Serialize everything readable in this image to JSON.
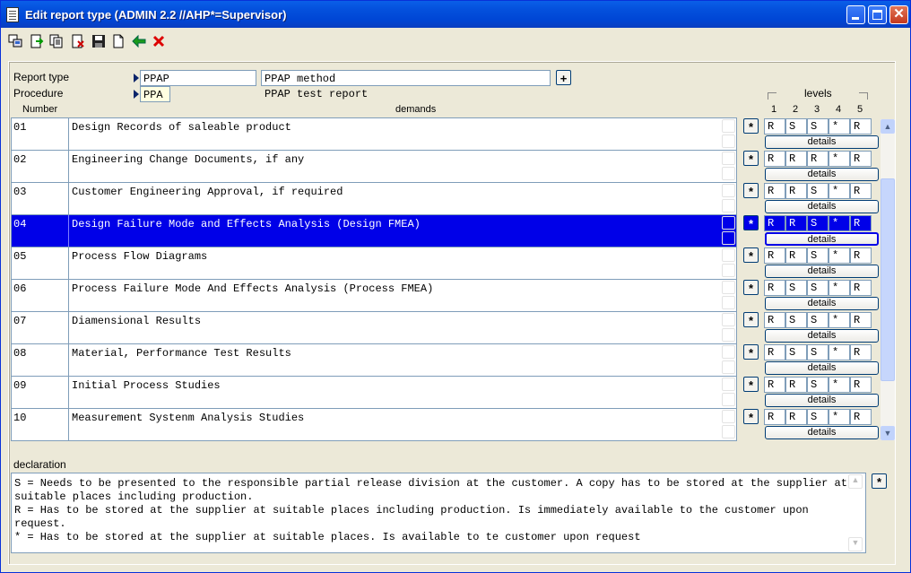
{
  "window": {
    "title": "Edit report type (ADMIN 2.2 //AHP*=Supervisor)"
  },
  "form": {
    "report_type_label": "Report type",
    "report_type_value": "PPAP",
    "report_type_desc": "PPAP method",
    "procedure_label": "Procedure",
    "procedure_value": "PPA",
    "procedure_desc": "PPAP test report",
    "add_button": "+"
  },
  "grid": {
    "col_number": "Number",
    "col_demands": "demands",
    "levels_label": "levels",
    "level_headers": [
      "1",
      "2",
      "3",
      "4",
      "5"
    ],
    "details_label": "details",
    "row_button": "*",
    "rows": [
      {
        "number": "01",
        "demand": "Design Records of saleable product",
        "levels": [
          "R",
          "S",
          "S",
          "*",
          "R"
        ]
      },
      {
        "number": "02",
        "demand": "Engineering Change Documents, if any",
        "levels": [
          "R",
          "R",
          "R",
          "*",
          "R"
        ]
      },
      {
        "number": "03",
        "demand": "Customer Engineering Approval, if required",
        "levels": [
          "R",
          "R",
          "S",
          "*",
          "R"
        ]
      },
      {
        "number": "04",
        "demand": "Design Failure Mode and Effects Analysis (Design FMEA)",
        "levels": [
          "R",
          "R",
          "S",
          "*",
          "R"
        ]
      },
      {
        "number": "05",
        "demand": "Process Flow Diagrams",
        "levels": [
          "R",
          "R",
          "S",
          "*",
          "R"
        ]
      },
      {
        "number": "06",
        "demand": "Process Failure Mode And Effects Analysis (Process FMEA)",
        "levels": [
          "R",
          "S",
          "S",
          "*",
          "R"
        ]
      },
      {
        "number": "07",
        "demand": "Diamensional Results",
        "levels": [
          "R",
          "S",
          "S",
          "*",
          "R"
        ]
      },
      {
        "number": "08",
        "demand": "Material, Performance Test Results",
        "levels": [
          "R",
          "S",
          "S",
          "*",
          "R"
        ]
      },
      {
        "number": "09",
        "demand": "Initial Process Studies",
        "levels": [
          "R",
          "R",
          "S",
          "*",
          "R"
        ]
      },
      {
        "number": "10",
        "demand": "Measurement Systenm Analysis Studies",
        "levels": [
          "R",
          "R",
          "S",
          "*",
          "R"
        ]
      }
    ],
    "selected_row": "04"
  },
  "declaration": {
    "label": "declaration",
    "text": "S = Needs to be presented to the responsible partial release division at the customer. A copy has to be stored at the supplier at\nsuitable places including production.\nR = Has to be stored at the supplier at suitable places including production. Is immediately available to the customer upon request.\n* = Has to be stored at the supplier at suitable places. Is available to te customer upon request",
    "button": "*"
  },
  "toolbar": {
    "icons": [
      "screens-icon",
      "export-icon",
      "copy-icon",
      "delete-icon",
      "save-icon",
      "new-document-icon",
      "back-arrow-icon",
      "cancel-icon"
    ]
  },
  "colors": {
    "selection": "#0000E8",
    "titlebar": "#0055E5",
    "panel": "#ECE9D8"
  }
}
